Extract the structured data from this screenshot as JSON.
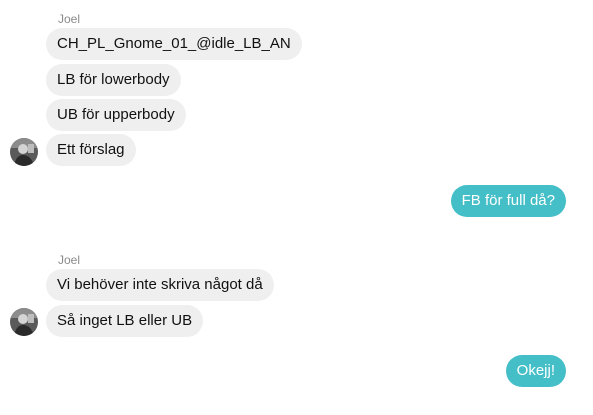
{
  "messages": {
    "group1": {
      "sender": "Joel",
      "lines": [
        "CH_PL_Gnome_01_@idle_LB_AN",
        "LB för lowerbody",
        "UB för upperbody",
        "Ett förslag"
      ]
    },
    "outgoing1": "FB för full då?",
    "group2": {
      "sender": "Joel",
      "lines": [
        "Vi behöver inte skriva något då",
        "Så inget LB eller UB"
      ]
    },
    "outgoing2": "Okejj!"
  },
  "colors": {
    "incoming_bubble": "#efefef",
    "outgoing_bubble": "#44bec7",
    "sender_name": "#8a8a8a"
  },
  "icons": {
    "avatar": "user-avatar-photo"
  }
}
